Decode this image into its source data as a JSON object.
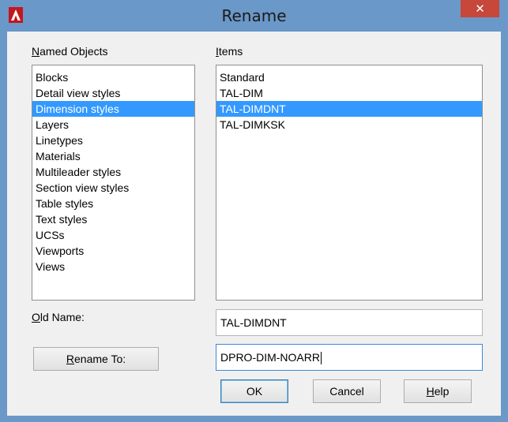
{
  "window": {
    "title": "Rename",
    "close_glyph": "✕",
    "accent": "#6a98c8",
    "close_color": "#c7473a",
    "app_icon": "autocad-logo-icon"
  },
  "named_objects": {
    "label_mnemonic": "N",
    "label_rest": "amed Objects",
    "items": [
      {
        "label": "Blocks",
        "selected": false
      },
      {
        "label": "Detail view styles",
        "selected": false
      },
      {
        "label": "Dimension styles",
        "selected": true
      },
      {
        "label": "Layers",
        "selected": false
      },
      {
        "label": "Linetypes",
        "selected": false
      },
      {
        "label": "Materials",
        "selected": false
      },
      {
        "label": "Multileader styles",
        "selected": false
      },
      {
        "label": "Section view styles",
        "selected": false
      },
      {
        "label": "Table styles",
        "selected": false
      },
      {
        "label": "Text styles",
        "selected": false
      },
      {
        "label": "UCSs",
        "selected": false
      },
      {
        "label": "Viewports",
        "selected": false
      },
      {
        "label": "Views",
        "selected": false
      }
    ]
  },
  "items": {
    "label_mnemonic": "I",
    "label_rest": "tems",
    "list": [
      {
        "label": "Standard",
        "selected": false
      },
      {
        "label": "TAL-DIM",
        "selected": false
      },
      {
        "label": "TAL-DIMDNT",
        "selected": true
      },
      {
        "label": "TAL-DIMKSK",
        "selected": false
      }
    ]
  },
  "old_name": {
    "label_mnemonic": "O",
    "label_rest": "ld Name:",
    "value": "TAL-DIMDNT"
  },
  "rename_to": {
    "button_mnemonic": "R",
    "button_rest": "ename To:",
    "value": "DPRO-DIM-NOARR"
  },
  "buttons": {
    "ok": "OK",
    "cancel": "Cancel",
    "help_mnemonic": "H",
    "help_rest": "elp"
  },
  "selection_color": "#3399ff"
}
